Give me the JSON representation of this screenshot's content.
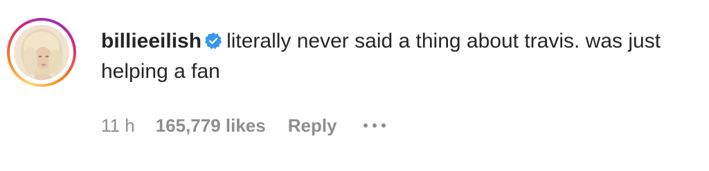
{
  "comment": {
    "username": "billieeilish",
    "verified": true,
    "text": "literally never said a thing about travis. was just helping a fan",
    "time": "11 h",
    "likes": "165,779 likes",
    "reply_label": "Reply"
  },
  "icons": {
    "verified": "verified-badge-icon",
    "more": "more-options-icon"
  },
  "colors": {
    "text": "#262626",
    "muted": "#8e8e8e",
    "verified": "#3897f0"
  }
}
